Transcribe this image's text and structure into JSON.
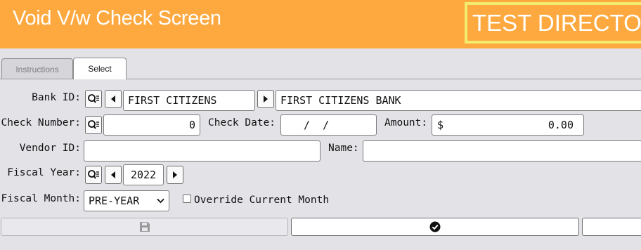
{
  "header": {
    "title": "Void V/w Check Screen",
    "environment_badge": "TEST DIRECTO"
  },
  "tabs": [
    {
      "label": "Instructions",
      "active": false
    },
    {
      "label": "Select",
      "active": true
    }
  ],
  "form": {
    "bank_id": {
      "label": "Bank ID:",
      "code": "FIRST CITIZENS",
      "description": "FIRST CITIZENS BANK"
    },
    "check_number": {
      "label": "Check Number:",
      "value": "0"
    },
    "check_date": {
      "label": "Check Date:",
      "value": "  /  /"
    },
    "amount": {
      "label": "Amount:",
      "currency": "$",
      "value": "0.00"
    },
    "vendor_id": {
      "label": "Vendor ID:",
      "value": ""
    },
    "name": {
      "label": "Name:",
      "value": ""
    },
    "fiscal_year": {
      "label": "Fiscal Year:",
      "value": "2022"
    },
    "fiscal_month": {
      "label": "Fiscal Month:",
      "selected": "PRE-YEAR"
    },
    "override_current_month": {
      "label": "Override Current Month",
      "checked": false
    }
  },
  "icons": {
    "lookup": "search-list-icon",
    "prev": "triangle-left-icon",
    "next": "triangle-right-icon",
    "save": "floppy-disk-icon",
    "confirm": "check-circle-icon"
  },
  "colors": {
    "header_bg": "#fda93f",
    "badge_border": "#f2ec6e",
    "page_bg": "#e3e2e7"
  }
}
